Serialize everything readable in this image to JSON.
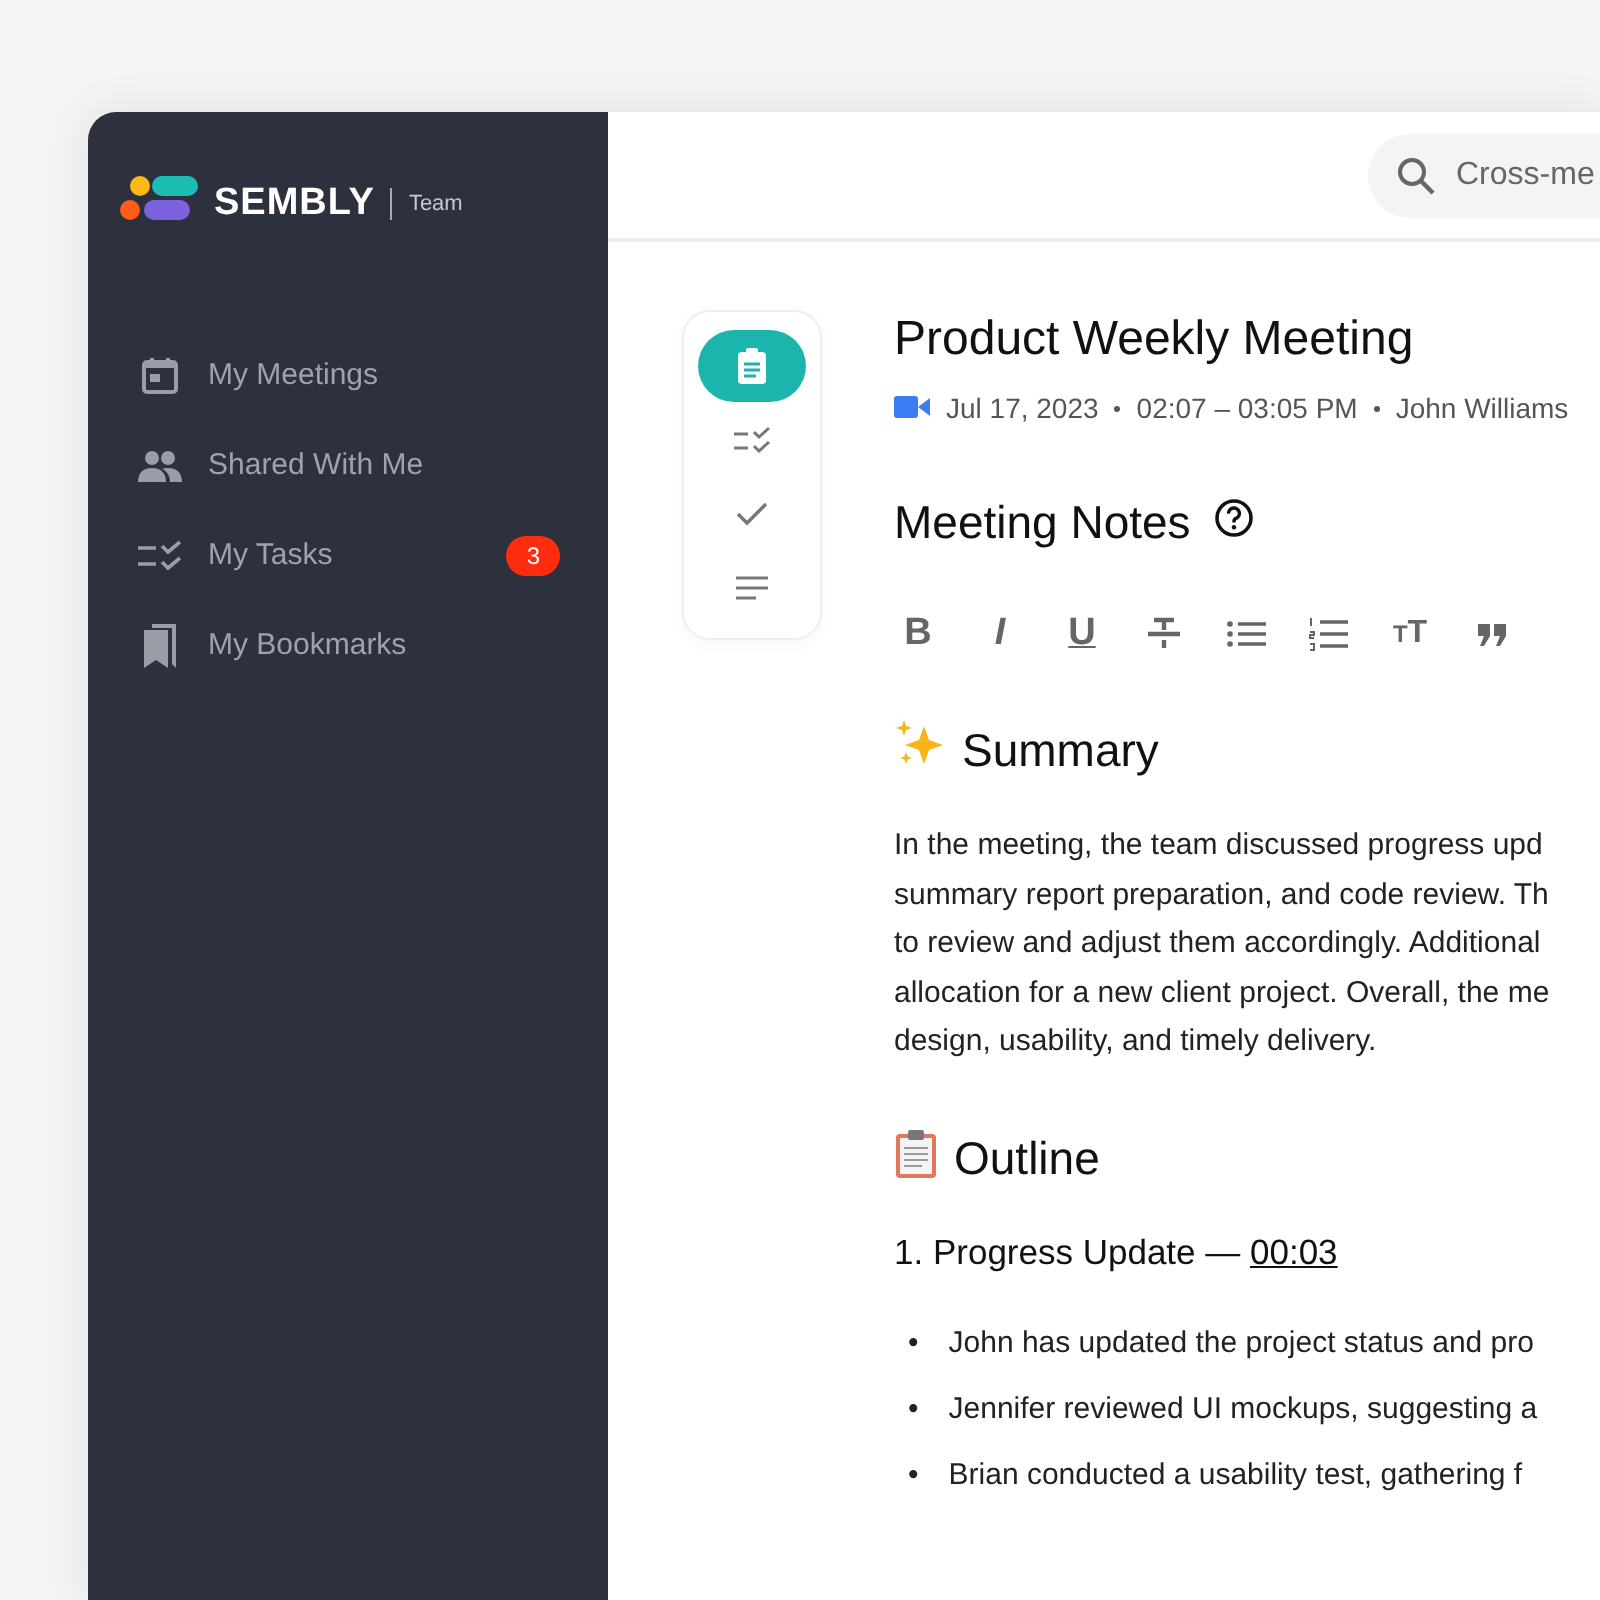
{
  "logo": {
    "name": "SEMBLY",
    "plan": "Team"
  },
  "sidebar": {
    "items": [
      {
        "kind": "calendar",
        "label": "My Meetings"
      },
      {
        "kind": "people",
        "label": "Shared With Me"
      },
      {
        "kind": "tasks",
        "label": "My Tasks",
        "badge": "3"
      },
      {
        "kind": "bookmarks",
        "label": "My Bookmarks"
      }
    ]
  },
  "search": {
    "placeholder": "Cross-me"
  },
  "side_tabs": [
    {
      "kind": "notes",
      "selected": true
    },
    {
      "kind": "tasks",
      "selected": false
    },
    {
      "kind": "done",
      "selected": false
    },
    {
      "kind": "transcript",
      "selected": false
    }
  ],
  "meeting": {
    "title": "Product Weekly Meeting",
    "date": "Jul 17, 2023",
    "time": "02:07 – 03:05 PM",
    "host": "John Williams"
  },
  "notes": {
    "heading": "Meeting Notes",
    "toolbar": [
      {
        "kind": "bold",
        "label": "B"
      },
      {
        "kind": "italic",
        "label": "I"
      },
      {
        "kind": "underline",
        "label": "U"
      },
      {
        "kind": "strike"
      },
      {
        "kind": "bullets"
      },
      {
        "kind": "numbers"
      },
      {
        "kind": "size",
        "label": "TT"
      },
      {
        "kind": "quote"
      }
    ],
    "summary": {
      "heading": "Summary",
      "lines": [
        "In the meeting, the team discussed progress upd",
        "summary report preparation, and code review. Th",
        "to review and adjust them accordingly. Additional",
        "allocation for a new client project. Overall, the me",
        "design, usability, and timely delivery."
      ]
    },
    "outline": {
      "heading": "Outline",
      "sections": [
        {
          "title": "1. Progress Update — ",
          "time": "00:03",
          "marker": "•",
          "bullets": [
            "John has updated the project status and pro",
            "Jennifer reviewed UI mockups, suggesting a",
            "Brian conducted a usability test, gathering f"
          ]
        }
      ]
    }
  }
}
